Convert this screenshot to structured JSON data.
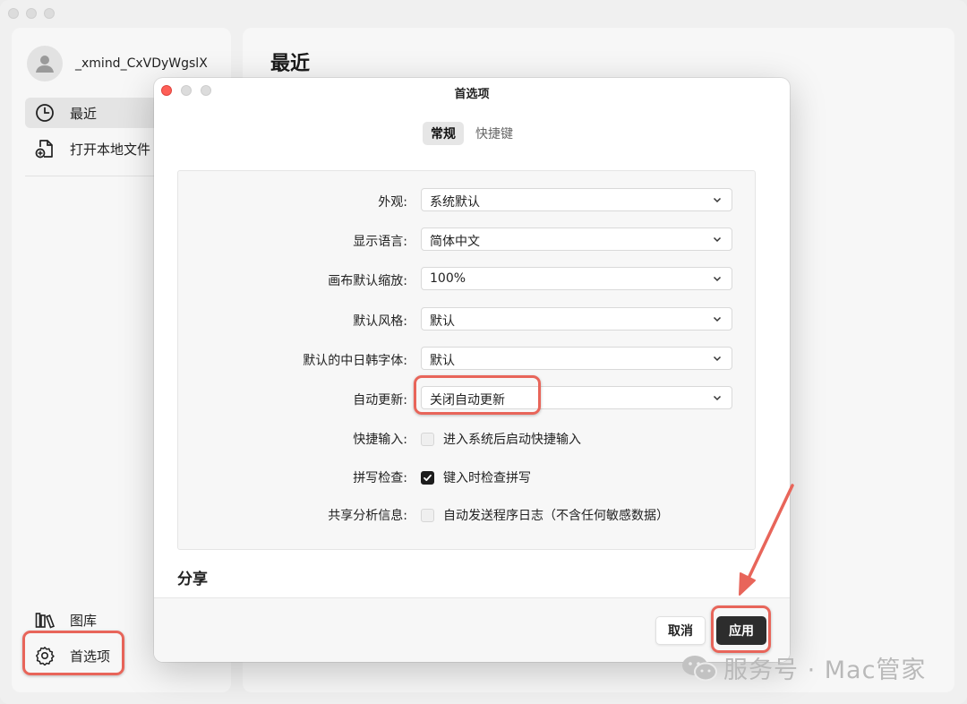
{
  "user": {
    "name": "_xmind_CxVDyWgslX"
  },
  "sidebar": {
    "items": [
      {
        "label": "最近",
        "icon": "clock-icon"
      },
      {
        "label": "打开本地文件",
        "icon": "open-file-icon"
      }
    ],
    "bottom_items": [
      {
        "label": "图库",
        "icon": "library-icon"
      },
      {
        "label": "首选项",
        "icon": "gear-icon"
      }
    ]
  },
  "main": {
    "title": "最近"
  },
  "dialog": {
    "title": "首选项",
    "tabs": [
      {
        "label": "常规"
      },
      {
        "label": "快捷键"
      }
    ],
    "settings": [
      {
        "label": "外观:",
        "value": "系统默认"
      },
      {
        "label": "显示语言:",
        "value": "简体中文"
      },
      {
        "label": "画布默认缩放:",
        "value": "100%"
      },
      {
        "label": "默认风格:",
        "value": "默认"
      },
      {
        "label": "默认的中日韩字体:",
        "value": "默认"
      },
      {
        "label": "自动更新:",
        "value": "关闭自动更新"
      }
    ],
    "checkboxes": [
      {
        "label": "快捷输入:",
        "text": "进入系统后启动快捷输入",
        "checked": false
      },
      {
        "label": "拼写检查:",
        "text": "键入时检查拼写",
        "checked": true
      },
      {
        "label": "共享分析信息:",
        "text": "自动发送程序日志（不含任何敏感数据）",
        "checked": false
      }
    ],
    "section_share": "分享",
    "cancel_label": "取消",
    "apply_label": "应用"
  },
  "watermark": {
    "text": "服务号 · Mac管家",
    "icon": "wechat-icon"
  },
  "colors": {
    "highlight": "#e8655a",
    "apply_bg": "#2d2d2d"
  }
}
